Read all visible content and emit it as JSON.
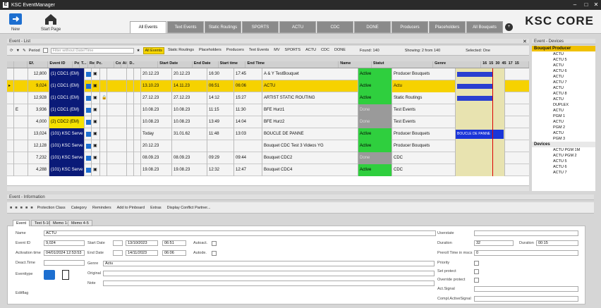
{
  "app": {
    "title": "KSC EventManager",
    "brand": "KSC CORE"
  },
  "ribbon": {
    "new_label": "New",
    "start_label": "Start Page"
  },
  "tabs": [
    "All Events",
    "Text Events",
    "Static Routings",
    "SPORTS",
    "ACTU",
    "CDC",
    "DONE",
    "Producers",
    "Placeholders",
    "All Bouquets"
  ],
  "event_list": {
    "title": "Event - List",
    "period_label": "Period",
    "filter_placeholder": "Filter without Date/Time",
    "chips": [
      "All Events",
      "Static Routings",
      "Placeholders",
      "Producers",
      "Text Events",
      "MV",
      "SPORTS",
      "ACTU",
      "CDC",
      "DONE"
    ],
    "found": "Found: 140",
    "showing": "Showing: 2 from 140",
    "selected": "Selected: One"
  },
  "columns": [
    "Ef.",
    "Event ID",
    "Position",
    "T...",
    "Re...",
    "Pc.",
    "Conflicts",
    "Ai",
    "D..",
    "Start Date",
    "End Date",
    "Start time",
    "End Time",
    "Name",
    "Statut",
    "Genre"
  ],
  "timeline": {
    "ticks": [
      "16",
      "15",
      "30",
      "45",
      "17",
      "15"
    ]
  },
  "rows": [
    {
      "id": "12,800",
      "pos": "(1) CDC1 (EM)",
      "start_date": "20.12.23",
      "end_date": "20.12.23",
      "start_time": "16:30",
      "end_time": "17:45",
      "name": "A & Y TestBouquet",
      "statut": "Active",
      "genre": "Producer Bouquets",
      "ef": ""
    },
    {
      "id": "9,024",
      "pos": "(1) CDC1 (EM)",
      "start_date": "13.10.23",
      "end_date": "14.11.23",
      "start_time": "06:51",
      "end_time": "06:06",
      "name": "ACTU",
      "statut": "Active",
      "genre": "Actu",
      "ef": ""
    },
    {
      "id": "12,928",
      "pos": "(1) CDC1 (EM)",
      "start_date": "27.12.23",
      "end_date": "27.12.23",
      "start_time": "14:12",
      "end_time": "15:27",
      "name": "ARTIST STATIC ROUTING",
      "statut": "Active",
      "genre": "Static Routings",
      "ef": ""
    },
    {
      "id": "3,936",
      "pos": "(1) CDC1 (EM)",
      "start_date": "10.08.23",
      "end_date": "10.08.23",
      "start_time": "11:15",
      "end_time": "11:30",
      "name": "BFE Hurz1",
      "statut": "Done",
      "genre": "Test Events",
      "ef": "E"
    },
    {
      "id": "4,000",
      "pos": "(2) CDC2 (EM)",
      "start_date": "10.08.23",
      "end_date": "10.08.23",
      "start_time": "13:49",
      "end_time": "14:04",
      "name": "BFE Hurz2",
      "statut": "Done",
      "genre": "Test Events",
      "ef": ""
    },
    {
      "id": "13,024",
      "pos": "(101) KSC Serve",
      "start_date": "Today",
      "end_date": "31.01.62",
      "start_time": "11:48",
      "end_time": "13:03",
      "name": "BOUCLE DE PANNE",
      "statut": "Active",
      "genre": "Producer Bouquets",
      "ef": ""
    },
    {
      "id": "12,128",
      "pos": "(101) KSC Serve",
      "start_date": "20.12.23",
      "end_date": "",
      "start_time": "",
      "end_time": "",
      "name": "Bouquet CDC Test 3 Videos YG",
      "statut": "Active",
      "genre": "Producer Bouquets",
      "ef": ""
    },
    {
      "id": "7,232",
      "pos": "(101) KSC Serve",
      "start_date": "08.09.23",
      "end_date": "08.09.23",
      "start_time": "09:29",
      "end_time": "09:44",
      "name": "Bouquet CDC2",
      "statut": "Done",
      "genre": "CDC",
      "ef": ""
    },
    {
      "id": "4,288",
      "pos": "(101) KSC Serve",
      "start_date": "19.08.23",
      "end_date": "19.08.23",
      "start_time": "12:32",
      "end_time": "12:47",
      "name": "Bouquet CDC4",
      "statut": "Active",
      "genre": "CDC",
      "ef": ""
    }
  ],
  "timeline_bar_label": "BOUCLE DE PANNE",
  "devices_panel": {
    "title": "Event - Devices",
    "group1": "Bouquet Producer",
    "items1": [
      "ACTU",
      "ACTU 5",
      "ACTU",
      "ACTU 6",
      "ACTU",
      "ACTU 7",
      "ACTU",
      "ACTU 8",
      "ACTU",
      "DUPLEX",
      "ACTU",
      "PGM 1",
      "ACTU",
      "PGM 2",
      "ACTU",
      "PGM 3"
    ],
    "group2": "Devices",
    "items2": [
      "ACTU PGM 1M",
      "ACTU PGM 2",
      "ACTU 5",
      "ACTU 6",
      "ACTU 7"
    ]
  },
  "info": {
    "title": "Event - Information",
    "toolbar": [
      "Protection Class",
      "Category",
      "Reminders",
      "Add to Pinboard",
      "Extras",
      "Display Conflict Partner..."
    ],
    "form_tabs": [
      "Event",
      "Text 5-10",
      "Memo 1-3",
      "Memo 4-5"
    ],
    "labels": {
      "name": "Name",
      "event_id": "Event ID",
      "activation": "Activation time",
      "deact": "Deact.Time",
      "eventtype": "Eventtype",
      "editflag": "Editflag",
      "start_date": "Start Date",
      "end_date": "End Date",
      "genre": "Genre",
      "original": "Original",
      "note": "Note",
      "autoact": "Autoact.",
      "autode": "Autode.",
      "userstate": "Userstate",
      "duration": "Duration",
      "duration2": "Duration",
      "preroll": "Preroll Time in mscs",
      "priority": "Priority",
      "set_protect": "Set protect",
      "override": "Override protect",
      "act_signal": "Act.Signal",
      "compl_signal": "Compl.ActiveSignal"
    },
    "values": {
      "name": "ACTU",
      "event_id": "9,024",
      "activation": "04/01/2024 12:53:53",
      "start_date": "13/10/2023",
      "start_time": "06:51",
      "end_date": "14/11/2023",
      "end_time": "06:06",
      "genre": "Actu",
      "duration": "32",
      "duration2": "00:15",
      "preroll": "0"
    }
  },
  "colors": {
    "position_blue": "#0a1a78",
    "active_green": "#2fcf3e",
    "highlight_yellow": "#f6d200"
  }
}
